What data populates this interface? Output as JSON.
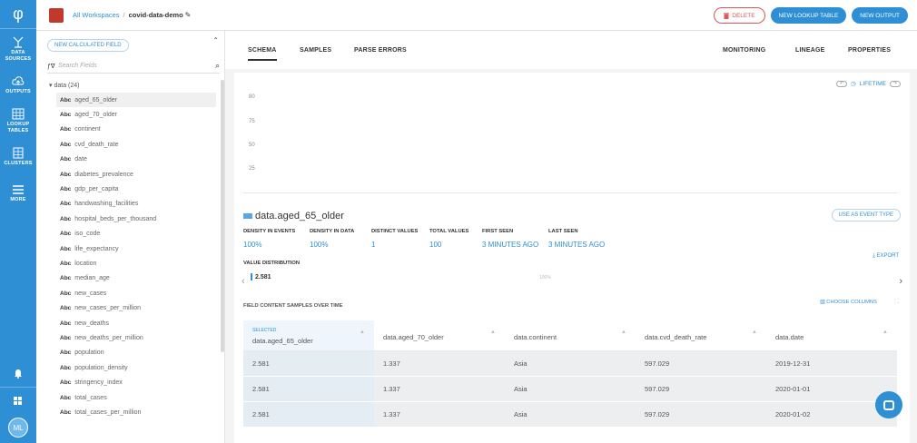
{
  "colors": {
    "accent": "#2f8fd4",
    "danger": "#e05555",
    "brand": "#c0392b"
  },
  "leftnav": {
    "logo": "φ",
    "items": [
      {
        "label": "DATA SOURCES",
        "icon": "data-sources-icon"
      },
      {
        "label": "OUTPUTS",
        "icon": "cloud-upload-icon"
      },
      {
        "label": "LOOKUP TABLES",
        "icon": "table-icon"
      },
      {
        "label": "CLUSTERS",
        "icon": "cluster-icon"
      },
      {
        "label": "MORE",
        "icon": "menu-icon"
      }
    ],
    "bottom": {
      "bell": "bell-icon",
      "grid": "apps-icon",
      "avatar": "ML"
    }
  },
  "header": {
    "crumb_root": "All Workspaces",
    "crumb_sep": "/",
    "crumb_current": "covid-data-demo",
    "delete_label": "DELETE",
    "new_lookup_label": "NEW LOOKUP TABLE",
    "new_output_label": "NEW OUTPUT"
  },
  "fieldpanel": {
    "new_calc_label": "NEW CALCULATED FIELD",
    "search_placeholder": "Search Fields",
    "group_label": "data (24)",
    "type_label": "Abc",
    "fields": [
      "aged_65_older",
      "aged_70_older",
      "continent",
      "cvd_death_rate",
      "date",
      "diabetes_prevalence",
      "gdp_per_capita",
      "handwashing_facilities",
      "hospital_beds_per_thousand",
      "iso_code",
      "life_expectancy",
      "location",
      "median_age",
      "new_cases",
      "new_cases_per_million",
      "new_deaths",
      "new_deaths_per_million",
      "population",
      "population_density",
      "stringency_index",
      "total_cases",
      "total_cases_per_million"
    ]
  },
  "tabs": {
    "schema": "SCHEMA",
    "samples": "SAMPLES",
    "parse_errors": "PARSE ERRORS",
    "monitoring": "MONITORING",
    "lineage": "LINEAGE",
    "properties": "PROPERTIES"
  },
  "timeline": {
    "lifetime_label": "LIFETIME",
    "yticks": [
      "80",
      "75",
      "50",
      "25"
    ]
  },
  "field": {
    "name": "data.aged_65_older",
    "use_event_label": "USE AS EVENT TYPE",
    "stats": [
      {
        "label": "DENSITY IN EVENTS",
        "value": "100%"
      },
      {
        "label": "DENSITY IN DATA",
        "value": "100%"
      },
      {
        "label": "DISTINCT VALUES",
        "value": "1"
      },
      {
        "label": "TOTAL VALUES",
        "value": "100"
      },
      {
        "label": "FIRST SEEN",
        "value": "3 MINUTES AGO"
      },
      {
        "label": "LAST SEEN",
        "value": "3 MINUTES AGO"
      }
    ],
    "export_label": "EXPORT",
    "value_distribution_label": "VALUE DISTRIBUTION",
    "vd_value": "2.581",
    "vd_pct": "100%"
  },
  "samples": {
    "title": "FIELD CONTENT SAMPLES OVER TIME",
    "choose_columns_label": "CHOOSE COLUMNS",
    "selected_tag": "SELECTED",
    "columns": [
      "data.aged_65_older",
      "data.aged_70_older",
      "data.continent",
      "data.cvd_death_rate",
      "data.date"
    ],
    "rows": [
      [
        "2.581",
        "1.337",
        "Asia",
        "597.029",
        "2019-12-31"
      ],
      [
        "2.581",
        "1.337",
        "Asia",
        "597.029",
        "2020-01-01"
      ],
      [
        "2.581",
        "1.337",
        "Asia",
        "597.029",
        "2020-01-02"
      ]
    ]
  }
}
